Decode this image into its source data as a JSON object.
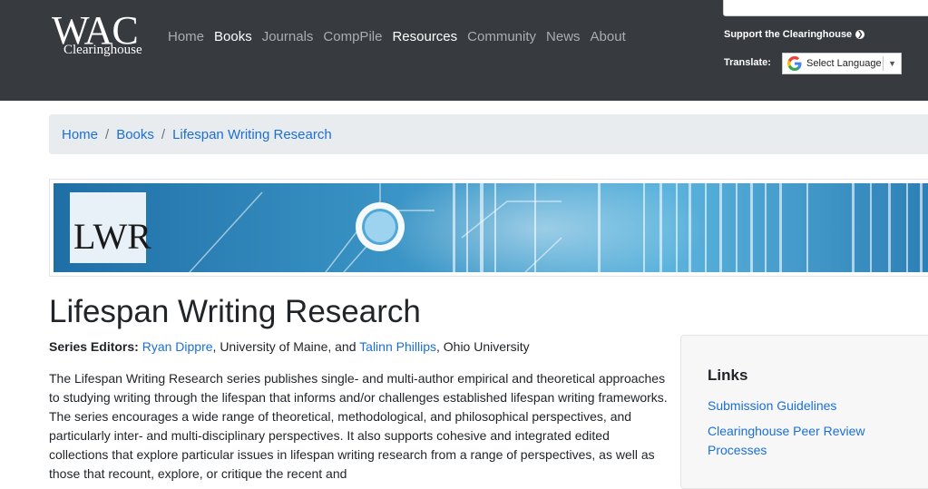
{
  "header": {
    "logo": {
      "main": "WAC",
      "sub": "Clearinghouse"
    },
    "nav": [
      {
        "label": "Home",
        "active": false
      },
      {
        "label": "Books",
        "active": true
      },
      {
        "label": "Journals",
        "active": false
      },
      {
        "label": "CompPile",
        "active": false
      },
      {
        "label": "Resources",
        "active": true
      },
      {
        "label": "Community",
        "active": false
      },
      {
        "label": "News",
        "active": false
      },
      {
        "label": "About",
        "active": false
      }
    ],
    "support_label": "Support the Clearinghouse",
    "support_icon": "arrow-right-circle-icon",
    "translate_label": "Translate:",
    "translate_value": "Select Language",
    "colors": {
      "bar_bg": "#373a3f",
      "nav_inactive": "#a9acb0",
      "nav_active": "#ffffff"
    }
  },
  "breadcrumb": [
    "Home",
    "Books",
    "Lifespan Writing Research"
  ],
  "banner": {
    "logo_text": "LWR"
  },
  "main": {
    "title": "Lifespan Writing Research",
    "editors_label": "Series Editors:",
    "editor1": "Ryan Dippre",
    "editor1_affil": ", University of Maine, and ",
    "editor2": "Talinn Phillips",
    "editor2_affil": ", Ohio University",
    "description": "The Lifespan Writing Research series publishes single- and multi-author empirical and theoretical approaches to studying writing through the lifespan that informs and/or challenges established lifespan writing frameworks. The series encourages a wide range of theoretical, methodological, and philosophical perspectives, and particularly inter- and multi-disciplinary perspectives. It also supports cohesive and integrated edited collections that explore particular issues in lifespan writing research from a range of perspectives, as well as those that recount, explore, or critique the recent and"
  },
  "sidebar": {
    "title": "Links",
    "links": [
      "Submission Guidelines",
      "Clearinghouse Peer Review Processes"
    ]
  },
  "colors": {
    "link": "#1a6fd8",
    "breadcrumb_bg": "#e9ecef",
    "banner_blue": "#2f86b8"
  }
}
